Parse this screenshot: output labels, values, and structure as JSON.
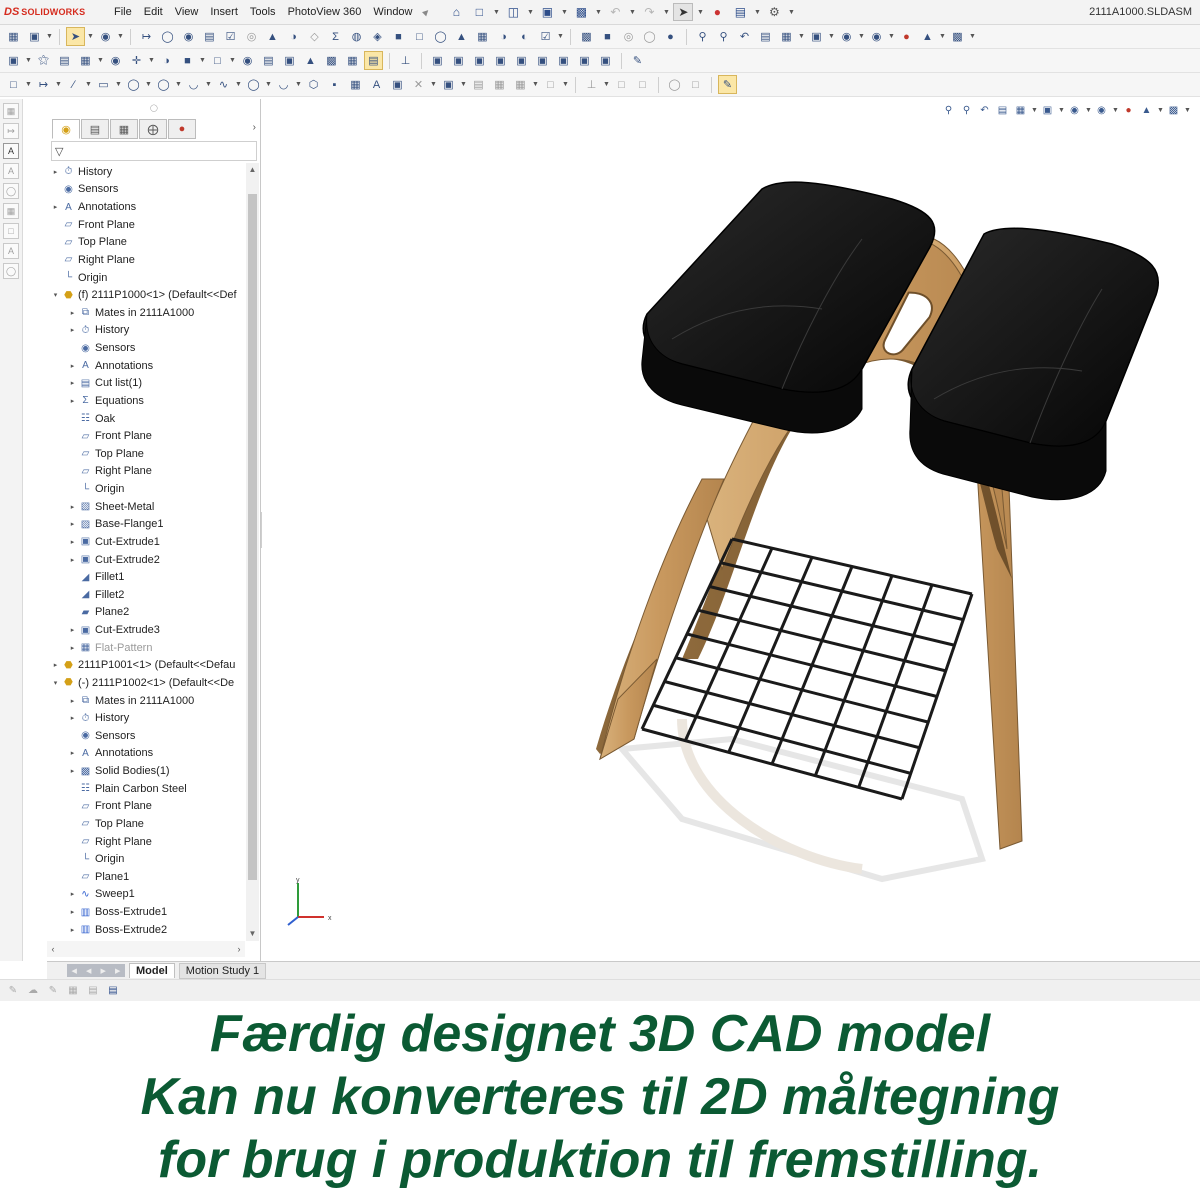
{
  "app": {
    "logo_mark": "DS",
    "logo_text": "SOLIDWORKS",
    "document_title": "2111A1000.SLDASM"
  },
  "menu": [
    "File",
    "Edit",
    "View",
    "Insert",
    "Tools",
    "PhotoView 360",
    "Window"
  ],
  "feature_tree": {
    "items": [
      {
        "label": "History",
        "depth": 0,
        "expandable": true,
        "icon": "history-icon"
      },
      {
        "label": "Sensors",
        "depth": 0,
        "expandable": false,
        "icon": "sensors-icon"
      },
      {
        "label": "Annotations",
        "depth": 0,
        "expandable": true,
        "icon": "annotations-icon"
      },
      {
        "label": "Front Plane",
        "depth": 0,
        "expandable": false,
        "icon": "plane-icon"
      },
      {
        "label": "Top Plane",
        "depth": 0,
        "expandable": false,
        "icon": "plane-icon"
      },
      {
        "label": "Right Plane",
        "depth": 0,
        "expandable": false,
        "icon": "plane-icon"
      },
      {
        "label": "Origin",
        "depth": 0,
        "expandable": false,
        "icon": "origin-icon"
      },
      {
        "label": "(f) 2111P1000<1> (Default<<Def",
        "depth": 0,
        "expandable": true,
        "expanded": true,
        "icon": "part-icon"
      },
      {
        "label": "Mates in 2111A1000",
        "depth": 1,
        "expandable": true,
        "icon": "mates-icon"
      },
      {
        "label": "History",
        "depth": 1,
        "expandable": true,
        "icon": "history-icon"
      },
      {
        "label": "Sensors",
        "depth": 1,
        "expandable": false,
        "icon": "sensors-icon"
      },
      {
        "label": "Annotations",
        "depth": 1,
        "expandable": true,
        "icon": "annotations-icon"
      },
      {
        "label": "Cut list(1)",
        "depth": 1,
        "expandable": true,
        "icon": "cut-list-icon"
      },
      {
        "label": "Equations",
        "depth": 1,
        "expandable": true,
        "icon": "equations-icon"
      },
      {
        "label": "Oak",
        "depth": 1,
        "expandable": false,
        "icon": "material-icon"
      },
      {
        "label": "Front Plane",
        "depth": 1,
        "expandable": false,
        "icon": "plane-icon"
      },
      {
        "label": "Top Plane",
        "depth": 1,
        "expandable": false,
        "icon": "plane-icon"
      },
      {
        "label": "Right Plane",
        "depth": 1,
        "expandable": false,
        "icon": "plane-icon"
      },
      {
        "label": "Origin",
        "depth": 1,
        "expandable": false,
        "icon": "origin-icon"
      },
      {
        "label": "Sheet-Metal",
        "depth": 1,
        "expandable": true,
        "icon": "sheet-metal-icon"
      },
      {
        "label": "Base-Flange1",
        "depth": 1,
        "expandable": true,
        "icon": "base-flange-icon"
      },
      {
        "label": "Cut-Extrude1",
        "depth": 1,
        "expandable": true,
        "icon": "cut-extrude-icon"
      },
      {
        "label": "Cut-Extrude2",
        "depth": 1,
        "expandable": true,
        "icon": "cut-extrude-icon"
      },
      {
        "label": "Fillet1",
        "depth": 1,
        "expandable": false,
        "icon": "fillet-icon"
      },
      {
        "label": "Fillet2",
        "depth": 1,
        "expandable": false,
        "icon": "fillet-icon"
      },
      {
        "label": "Plane2",
        "depth": 1,
        "expandable": false,
        "icon": "plane-feature-icon"
      },
      {
        "label": "Cut-Extrude3",
        "depth": 1,
        "expandable": true,
        "icon": "cut-extrude-icon"
      },
      {
        "label": "Flat-Pattern",
        "depth": 1,
        "expandable": true,
        "icon": "flat-pattern-icon",
        "grayed": true
      },
      {
        "label": "2111P1001<1> (Default<<Defau",
        "depth": 0,
        "expandable": true,
        "icon": "part-icon"
      },
      {
        "label": "(-) 2111P1002<1> (Default<<De",
        "depth": 0,
        "expandable": true,
        "expanded": true,
        "icon": "part-icon"
      },
      {
        "label": "Mates in 2111A1000",
        "depth": 1,
        "expandable": true,
        "icon": "mates-icon"
      },
      {
        "label": "History",
        "depth": 1,
        "expandable": true,
        "icon": "history-icon"
      },
      {
        "label": "Sensors",
        "depth": 1,
        "expandable": false,
        "icon": "sensors-icon"
      },
      {
        "label": "Annotations",
        "depth": 1,
        "expandable": true,
        "icon": "annotations-icon"
      },
      {
        "label": "Solid Bodies(1)",
        "depth": 1,
        "expandable": true,
        "icon": "solid-bodies-icon"
      },
      {
        "label": "Plain Carbon Steel",
        "depth": 1,
        "expandable": false,
        "icon": "material-icon"
      },
      {
        "label": "Front Plane",
        "depth": 1,
        "expandable": false,
        "icon": "plane-icon"
      },
      {
        "label": "Top Plane",
        "depth": 1,
        "expandable": false,
        "icon": "plane-icon"
      },
      {
        "label": "Right Plane",
        "depth": 1,
        "expandable": false,
        "icon": "plane-icon"
      },
      {
        "label": "Origin",
        "depth": 1,
        "expandable": false,
        "icon": "origin-icon"
      },
      {
        "label": "Plane1",
        "depth": 1,
        "expandable": false,
        "icon": "plane-icon"
      },
      {
        "label": "Sweep1",
        "depth": 1,
        "expandable": true,
        "icon": "sweep-icon"
      },
      {
        "label": "Boss-Extrude1",
        "depth": 1,
        "expandable": true,
        "icon": "boss-extrude-icon"
      },
      {
        "label": "Boss-Extrude2",
        "depth": 1,
        "expandable": true,
        "icon": "boss-extrude-icon"
      }
    ]
  },
  "bottom_tabs": [
    {
      "label": "Model",
      "active": true
    },
    {
      "label": "Motion Study 1",
      "active": false
    }
  ],
  "triad": {
    "x_label": "x",
    "y_label": "y"
  },
  "caption": {
    "line1": "Færdig designet 3D CAD model",
    "line2": "Kan nu konverteres til 2D måltegning",
    "line3": "for brug i produktion til fremstilling.",
    "color": "#0b5a33"
  },
  "colors": {
    "logo_red": "#d52b1e",
    "wood": "#caa06a",
    "cushion": "#111111",
    "grid_steel": "#1a1a1a"
  }
}
